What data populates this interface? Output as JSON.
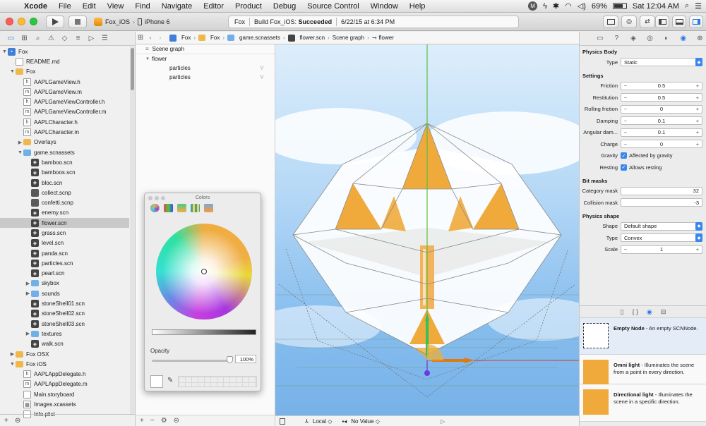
{
  "menubar": {
    "apple": "",
    "items": [
      "Xcode",
      "File",
      "Edit",
      "View",
      "Find",
      "Navigate",
      "Editor",
      "Product",
      "Debug",
      "Source Control",
      "Window",
      "Help"
    ],
    "battery": "69%",
    "clock": "Sat 12:04 AM",
    "avatar_letter": "M"
  },
  "toolbar": {
    "scheme": "Fox_iOS",
    "device": "iPhone 6",
    "activity_project": "Fox",
    "activity_status_prefix": "Build Fox_iOS: ",
    "activity_status_bold": "Succeeded",
    "activity_time": "6/22/15 at 6:34 PM"
  },
  "navigator": {
    "tree": [
      {
        "label": "Fox",
        "indent": 0,
        "disc": "▼",
        "icon": "proj"
      },
      {
        "label": "README.md",
        "indent": 1,
        "disc": "",
        "icon": "doc"
      },
      {
        "label": "Fox",
        "indent": 1,
        "disc": "▼",
        "icon": "folder"
      },
      {
        "label": "AAPLGameView.h",
        "indent": 2,
        "disc": "",
        "icon": "h"
      },
      {
        "label": "AAPLGameView.m",
        "indent": 2,
        "disc": "",
        "icon": "m"
      },
      {
        "label": "AAPLGameViewController.h",
        "indent": 2,
        "disc": "",
        "icon": "h"
      },
      {
        "label": "AAPLGameViewController.m",
        "indent": 2,
        "disc": "",
        "icon": "m"
      },
      {
        "label": "AAPLCharacter.h",
        "indent": 2,
        "disc": "",
        "icon": "h"
      },
      {
        "label": "AAPLCharacter.m",
        "indent": 2,
        "disc": "",
        "icon": "m"
      },
      {
        "label": "Overlays",
        "indent": 2,
        "disc": "▶",
        "icon": "folder"
      },
      {
        "label": "game.scnassets",
        "indent": 2,
        "disc": "▼",
        "icon": "folder-blue"
      },
      {
        "label": "bamboo.scn",
        "indent": 3,
        "disc": "",
        "icon": "scn"
      },
      {
        "label": "bamboos.scn",
        "indent": 3,
        "disc": "",
        "icon": "scn"
      },
      {
        "label": "bloc.scn",
        "indent": 3,
        "disc": "",
        "icon": "scn"
      },
      {
        "label": "collect.scnp",
        "indent": 3,
        "disc": "",
        "icon": "cube"
      },
      {
        "label": "confetti.scnp",
        "indent": 3,
        "disc": "",
        "icon": "cube"
      },
      {
        "label": "enemy.scn",
        "indent": 3,
        "disc": "",
        "icon": "scn"
      },
      {
        "label": "flower.scn",
        "indent": 3,
        "disc": "",
        "icon": "scn",
        "selected": true
      },
      {
        "label": "grass.scn",
        "indent": 3,
        "disc": "",
        "icon": "scn"
      },
      {
        "label": "level.scn",
        "indent": 3,
        "disc": "",
        "icon": "scn"
      },
      {
        "label": "panda.scn",
        "indent": 3,
        "disc": "",
        "icon": "scn"
      },
      {
        "label": "particles.scn",
        "indent": 3,
        "disc": "",
        "icon": "scn"
      },
      {
        "label": "pearl.scn",
        "indent": 3,
        "disc": "",
        "icon": "scn"
      },
      {
        "label": "skybox",
        "indent": 3,
        "disc": "▶",
        "icon": "folder-blue"
      },
      {
        "label": "sounds",
        "indent": 3,
        "disc": "▶",
        "icon": "folder-blue"
      },
      {
        "label": "stoneShell01.scn",
        "indent": 3,
        "disc": "",
        "icon": "scn"
      },
      {
        "label": "stoneShell02.scn",
        "indent": 3,
        "disc": "",
        "icon": "scn"
      },
      {
        "label": "stoneShell03.scn",
        "indent": 3,
        "disc": "",
        "icon": "scn"
      },
      {
        "label": "textures",
        "indent": 3,
        "disc": "▶",
        "icon": "folder-blue"
      },
      {
        "label": "walk.scn",
        "indent": 3,
        "disc": "",
        "icon": "scn"
      },
      {
        "label": "Fox OSX",
        "indent": 1,
        "disc": "▶",
        "icon": "folder"
      },
      {
        "label": "Fox iOS",
        "indent": 1,
        "disc": "▼",
        "icon": "folder"
      },
      {
        "label": "AAPLAppDelegate.h",
        "indent": 2,
        "disc": "",
        "icon": "h"
      },
      {
        "label": "AAPLAppDelegate.m",
        "indent": 2,
        "disc": "",
        "icon": "m"
      },
      {
        "label": "Main.storyboard",
        "indent": 2,
        "disc": "",
        "icon": "doc"
      },
      {
        "label": "Images.xcassets",
        "indent": 2,
        "disc": "",
        "icon": "assets"
      },
      {
        "label": "Info.plist",
        "indent": 2,
        "disc": "",
        "icon": "doc"
      }
    ]
  },
  "jumpbar": {
    "segments": [
      "Fox",
      "Fox",
      "game.scnassets",
      "flower.scn",
      "Scene graph",
      "flower"
    ]
  },
  "outline": {
    "title": "Scene graph",
    "nodes": [
      {
        "label": "flower",
        "indent": 0,
        "disc": "▼"
      },
      {
        "label": "particles",
        "indent": 1,
        "disc": ""
      },
      {
        "label": "particles",
        "indent": 1,
        "disc": ""
      }
    ]
  },
  "colors_panel": {
    "title": "Colors",
    "opacity_label": "Opacity",
    "opacity_value": "100%",
    "opacity_fraction": 1.0
  },
  "viewport_bar": {
    "space": "Local",
    "value": "No Value"
  },
  "inspector": {
    "physics_body": {
      "title": "Physics Body",
      "type_label": "Type",
      "type_value": "Static"
    },
    "settings": {
      "title": "Settings",
      "rows": [
        {
          "label": "Friction",
          "value": "0.5"
        },
        {
          "label": "Restitution",
          "value": "0.5"
        },
        {
          "label": "Rolling friction",
          "value": "0"
        },
        {
          "label": "Damping",
          "value": "0.1"
        },
        {
          "label": "Angular dam...",
          "value": "0.1"
        },
        {
          "label": "Charge",
          "value": "0"
        }
      ],
      "gravity_label": "Gravity",
      "gravity_text": "Affected by gravity",
      "resting_label": "Resting",
      "resting_text": "Allows resting"
    },
    "bit_masks": {
      "title": "Bit masks",
      "category_label": "Category mask",
      "category_value": "32",
      "collision_label": "Collision mask",
      "collision_value": "-3"
    },
    "physics_shape": {
      "title": "Physics shape",
      "shape_label": "Shape",
      "shape_value": "Default shape",
      "type_label": "Type",
      "type_value": "Convex",
      "scale_label": "Scale",
      "scale_value": "1"
    }
  },
  "library": {
    "items": [
      {
        "name": "Empty Node",
        "desc": " - An empty SCNNode.",
        "thumb": "#ffffff"
      },
      {
        "name": "Omni light",
        "desc": " - Illuminates the scene from a point in every direction.",
        "thumb": "#f0aa3c"
      },
      {
        "name": "Directional light",
        "desc": " - Illuminates the scene in a specific direction.",
        "thumb": "#f0aa3c"
      }
    ]
  },
  "colors": {
    "accent": "#3b86ea",
    "flower_orange": "#f0aa3c",
    "sky": "#86bdee"
  }
}
